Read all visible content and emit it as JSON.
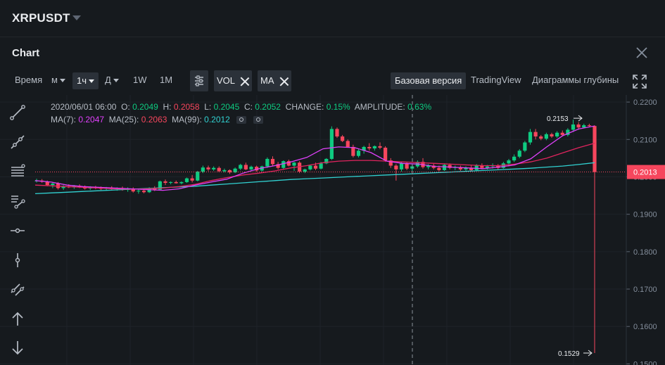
{
  "header": {
    "symbol": "XRPUSDT"
  },
  "chart_header": {
    "title": "Chart"
  },
  "toolbar": {
    "time_label": "Время",
    "minutes": "м",
    "interval_active": "1ч",
    "day": "Д",
    "week": "1W",
    "month": "1M",
    "indicators": [
      "VOL",
      "MA"
    ],
    "view_basic": "Базовая версия",
    "view_tradingview": "TradingView",
    "view_depth": "Диаграммы глубины"
  },
  "info": {
    "datetime": "2020/06/01 06:00",
    "o_label": "O:",
    "o": "0.2049",
    "h_label": "H:",
    "h": "0.2058",
    "l_label": "L:",
    "l": "0.2045",
    "c_label": "C:",
    "c": "0.2052",
    "change_label": "CHANGE:",
    "change": "0.15%",
    "amp_label": "AMPLITUDE:",
    "amp": "0.63%",
    "ma7_label": "MA(7):",
    "ma7": "0.2047",
    "ma25_label": "MA(25):",
    "ma25": "0.2063",
    "ma99_label": "MA(99):",
    "ma99": "0.2012"
  },
  "colors": {
    "up": "#0ecb81",
    "down": "#f6465d",
    "ma7": "#e040fb",
    "ma25": "#e0245e",
    "ma99": "#31d2d2"
  },
  "chart_data": {
    "type": "candlestick",
    "y_ticks": [
      "0.2200",
      "0.2100",
      "0.2000",
      "0.1900",
      "0.1800",
      "0.1700",
      "0.1600",
      "0.1500"
    ],
    "ylim": [
      0.1497,
      0.2219
    ],
    "current_price": "0.2013",
    "max_label": "0.2153",
    "min_label": "0.1529",
    "candles": [
      [
        0.1988,
        0.1995,
        0.1985,
        0.199
      ],
      [
        0.199,
        0.1994,
        0.1984,
        0.1987
      ],
      [
        0.1987,
        0.199,
        0.1975,
        0.1978
      ],
      [
        0.1978,
        0.1985,
        0.197,
        0.1982
      ],
      [
        0.1982,
        0.1986,
        0.1966,
        0.197
      ],
      [
        0.197,
        0.1978,
        0.1965,
        0.1975
      ],
      [
        0.1975,
        0.198,
        0.197,
        0.1972
      ],
      [
        0.1972,
        0.1978,
        0.1968,
        0.1976
      ],
      [
        0.1976,
        0.198,
        0.197,
        0.1973
      ],
      [
        0.1973,
        0.1977,
        0.1966,
        0.1969
      ],
      [
        0.1969,
        0.1975,
        0.1965,
        0.1972
      ],
      [
        0.1972,
        0.1976,
        0.1967,
        0.197
      ],
      [
        0.197,
        0.1974,
        0.1965,
        0.1968
      ],
      [
        0.1968,
        0.1973,
        0.1964,
        0.1971
      ],
      [
        0.1971,
        0.1975,
        0.1966,
        0.1967
      ],
      [
        0.1967,
        0.1972,
        0.1963,
        0.197
      ],
      [
        0.197,
        0.1974,
        0.1963,
        0.1965
      ],
      [
        0.1965,
        0.1972,
        0.196,
        0.1968
      ],
      [
        0.1968,
        0.1972,
        0.1958,
        0.1961
      ],
      [
        0.1961,
        0.1966,
        0.1955,
        0.1963
      ],
      [
        0.1963,
        0.1968,
        0.1956,
        0.1959
      ],
      [
        0.1959,
        0.1972,
        0.1957,
        0.197
      ],
      [
        0.197,
        0.1975,
        0.1962,
        0.1966
      ],
      [
        0.1966,
        0.199,
        0.1964,
        0.1988
      ],
      [
        0.1988,
        0.1993,
        0.1978,
        0.1984
      ],
      [
        0.1984,
        0.1988,
        0.198,
        0.1986
      ],
      [
        0.1986,
        0.199,
        0.1982,
        0.1983
      ],
      [
        0.1983,
        0.1988,
        0.198,
        0.1986
      ],
      [
        0.1986,
        0.1998,
        0.1984,
        0.1996
      ],
      [
        0.1996,
        0.2005,
        0.1985,
        0.199
      ],
      [
        0.199,
        0.2016,
        0.1988,
        0.2014
      ],
      [
        0.2014,
        0.203,
        0.201,
        0.2025
      ],
      [
        0.2025,
        0.203,
        0.2015,
        0.202
      ],
      [
        0.202,
        0.2028,
        0.2016,
        0.2024
      ],
      [
        0.2024,
        0.2028,
        0.2012,
        0.2015
      ],
      [
        0.2015,
        0.2022,
        0.2012,
        0.2018
      ],
      [
        0.2018,
        0.202,
        0.2008,
        0.2012
      ],
      [
        0.2012,
        0.2025,
        0.201,
        0.2022
      ],
      [
        0.2022,
        0.2035,
        0.2018,
        0.2032
      ],
      [
        0.2032,
        0.2038,
        0.2018,
        0.202
      ],
      [
        0.202,
        0.203,
        0.2015,
        0.2027
      ],
      [
        0.2027,
        0.203,
        0.2014,
        0.2017
      ],
      [
        0.2017,
        0.203,
        0.2014,
        0.2028
      ],
      [
        0.2028,
        0.2052,
        0.2024,
        0.2048
      ],
      [
        0.2048,
        0.2055,
        0.203,
        0.2034
      ],
      [
        0.2034,
        0.204,
        0.202,
        0.2024
      ],
      [
        0.2024,
        0.2044,
        0.2021,
        0.2042
      ],
      [
        0.2042,
        0.2046,
        0.2028,
        0.203
      ],
      [
        0.203,
        0.204,
        0.2016,
        0.2038
      ],
      [
        0.2038,
        0.2042,
        0.201,
        0.2014
      ],
      [
        0.2014,
        0.2022,
        0.201,
        0.202
      ],
      [
        0.202,
        0.2032,
        0.2017,
        0.203
      ],
      [
        0.203,
        0.2038,
        0.2018,
        0.2022
      ],
      [
        0.2022,
        0.204,
        0.202,
        0.2036
      ],
      [
        0.2036,
        0.205,
        0.2034,
        0.2048
      ],
      [
        0.2048,
        0.2135,
        0.2045,
        0.2128
      ],
      [
        0.2128,
        0.2132,
        0.2104,
        0.2108
      ],
      [
        0.2108,
        0.2112,
        0.2093,
        0.2096
      ],
      [
        0.2096,
        0.21,
        0.2078,
        0.208
      ],
      [
        0.208,
        0.2086,
        0.2052,
        0.2056
      ],
      [
        0.2056,
        0.2074,
        0.2052,
        0.207
      ],
      [
        0.207,
        0.2083,
        0.2062,
        0.208
      ],
      [
        0.208,
        0.209,
        0.207,
        0.2076
      ],
      [
        0.2076,
        0.2084,
        0.207,
        0.2082
      ],
      [
        0.2082,
        0.2092,
        0.2074,
        0.2078
      ],
      [
        0.2078,
        0.2082,
        0.204,
        0.2044
      ],
      [
        0.2044,
        0.205,
        0.2024,
        0.203
      ],
      [
        0.203,
        0.2034,
        0.199,
        0.202
      ],
      [
        0.202,
        0.204,
        0.2014,
        0.2036
      ],
      [
        0.2036,
        0.204,
        0.2018,
        0.2022
      ],
      [
        0.2022,
        0.2034,
        0.2014,
        0.2028
      ],
      [
        0.2028,
        0.2044,
        0.2024,
        0.204
      ],
      [
        0.204,
        0.205,
        0.2022,
        0.2026
      ],
      [
        0.2026,
        0.2034,
        0.202,
        0.203
      ],
      [
        0.203,
        0.2035,
        0.202,
        0.2024
      ],
      [
        0.2024,
        0.203,
        0.2015,
        0.2018
      ],
      [
        0.2018,
        0.2036,
        0.2016,
        0.2032
      ],
      [
        0.2032,
        0.2036,
        0.202,
        0.2024
      ],
      [
        0.2024,
        0.203,
        0.2018,
        0.2026
      ],
      [
        0.2026,
        0.203,
        0.2016,
        0.202
      ],
      [
        0.202,
        0.2028,
        0.2016,
        0.2024
      ],
      [
        0.2024,
        0.2032,
        0.2014,
        0.2018
      ],
      [
        0.2018,
        0.2034,
        0.2016,
        0.203
      ],
      [
        0.203,
        0.2036,
        0.202,
        0.2024
      ],
      [
        0.2024,
        0.2032,
        0.202,
        0.2028
      ],
      [
        0.2028,
        0.2036,
        0.2022,
        0.203
      ],
      [
        0.203,
        0.2034,
        0.202,
        0.2024
      ],
      [
        0.2024,
        0.204,
        0.2022,
        0.2036
      ],
      [
        0.2036,
        0.2048,
        0.2028,
        0.2044
      ],
      [
        0.2044,
        0.206,
        0.204,
        0.2054
      ],
      [
        0.2054,
        0.2074,
        0.205,
        0.207
      ],
      [
        0.207,
        0.2096,
        0.2066,
        0.2092
      ],
      [
        0.2092,
        0.2128,
        0.2086,
        0.212
      ],
      [
        0.212,
        0.2128,
        0.21,
        0.2108
      ],
      [
        0.2108,
        0.2112,
        0.2098,
        0.2102
      ],
      [
        0.2102,
        0.2118,
        0.2098,
        0.2114
      ],
      [
        0.2114,
        0.2118,
        0.2104,
        0.2108
      ],
      [
        0.2108,
        0.2122,
        0.2104,
        0.2118
      ],
      [
        0.2118,
        0.2124,
        0.2108,
        0.2112
      ],
      [
        0.2112,
        0.213,
        0.2108,
        0.2126
      ],
      [
        0.2126,
        0.2153,
        0.212,
        0.214
      ],
      [
        0.214,
        0.2146,
        0.2126,
        0.2132
      ],
      [
        0.2132,
        0.2142,
        0.213,
        0.2138
      ],
      [
        0.2138,
        0.2142,
        0.2133,
        0.2136
      ],
      [
        0.2136,
        0.2138,
        0.1529,
        0.2013
      ]
    ],
    "ma7": [
      0.199,
      0.1986,
      0.1978,
      0.1974,
      0.1972,
      0.197,
      0.1968,
      0.1966,
      0.1964,
      0.1968,
      0.1978,
      0.1986,
      0.1994,
      0.201,
      0.2022,
      0.203,
      0.204,
      0.2052,
      0.2075,
      0.208,
      0.2078,
      0.2065,
      0.2042,
      0.2036,
      0.2034,
      0.2028,
      0.2026,
      0.2024,
      0.2022,
      0.2026,
      0.2032,
      0.2048,
      0.208,
      0.211,
      0.2128,
      0.2136
    ],
    "ma25": [
      0.1978,
      0.1976,
      0.1974,
      0.1972,
      0.197,
      0.1968,
      0.1967,
      0.1968,
      0.197,
      0.1974,
      0.198,
      0.199,
      0.1998,
      0.2005,
      0.201,
      0.2016,
      0.2024,
      0.203,
      0.2038,
      0.2042,
      0.2044,
      0.2044,
      0.2042,
      0.204,
      0.2038,
      0.2036,
      0.2034,
      0.2032,
      0.203,
      0.203,
      0.2034,
      0.204,
      0.205,
      0.2064,
      0.2078,
      0.209
    ],
    "ma99": [
      0.1955,
      0.1957,
      0.1959,
      0.1961,
      0.1963,
      0.1965,
      0.1967,
      0.1969,
      0.1971,
      0.1973,
      0.1975,
      0.1978,
      0.1981,
      0.1984,
      0.1987,
      0.199,
      0.1993,
      0.1995,
      0.1997,
      0.1999,
      0.2001,
      0.2003,
      0.2005,
      0.2007,
      0.2009,
      0.2011,
      0.2013,
      0.2015,
      0.2017,
      0.2019,
      0.2021,
      0.2023,
      0.2026,
      0.2029,
      0.2033,
      0.2038
    ]
  }
}
